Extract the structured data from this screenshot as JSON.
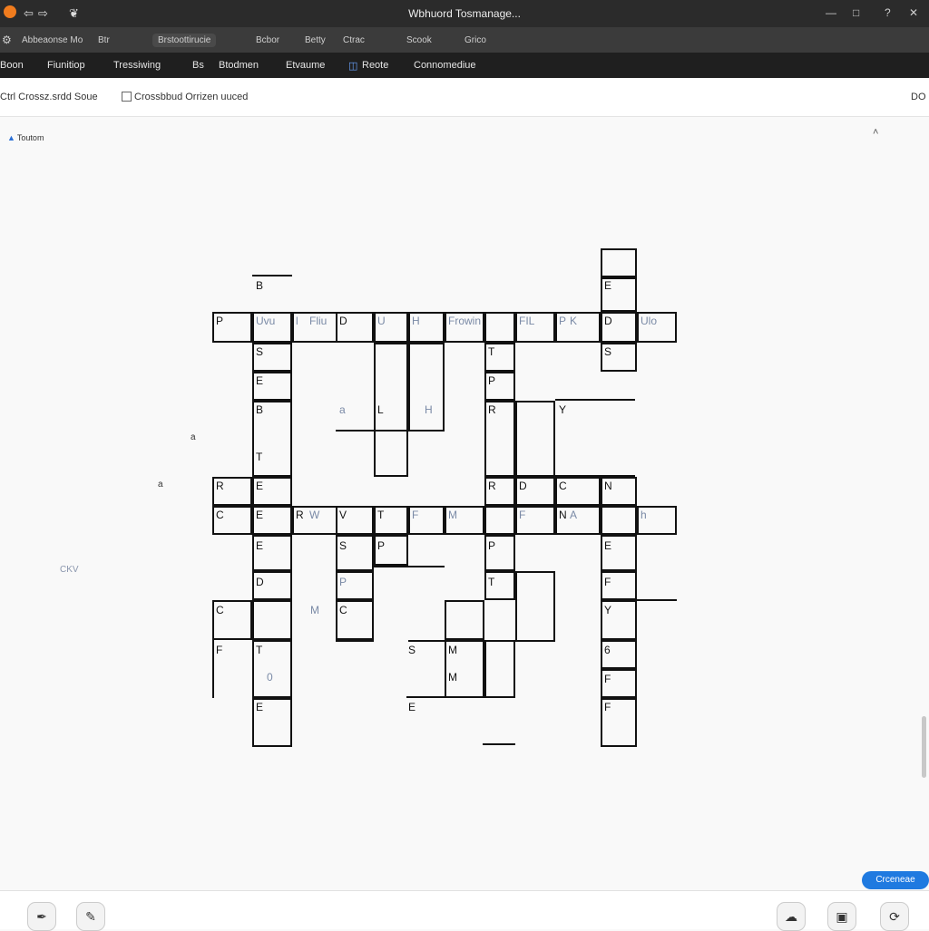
{
  "window": {
    "title": "Wbhuord Tosmanage..."
  },
  "toolbar": {
    "items": [
      "Abbeaonse Mo",
      "Btr",
      "Brstoottirucie",
      "Bcbor",
      "Betty",
      "Ctrac",
      "Scook",
      "Grico"
    ]
  },
  "menubar": {
    "items": [
      "Boon",
      "Fiunitiop",
      "Tressiwing",
      "Bs",
      "Btodmen",
      "Etvaume",
      "Reote",
      "Connomediue"
    ]
  },
  "options": {
    "title": "Ctrl Crossz.srdd Soue",
    "checkbox_label": "Crossbbud Orrizen uuced",
    "right_label": "DO"
  },
  "panel": {
    "title": "Toutom"
  },
  "side_marks": [
    "a",
    "a",
    "CKV"
  ],
  "crossword": {
    "letters": [
      "B",
      "E",
      "P",
      "Uvu",
      "l",
      "Fliu",
      "D",
      "U",
      "H",
      "Frowin",
      "FIL",
      "P",
      "K",
      "D",
      "Ulo",
      "S",
      "T",
      "S",
      "E",
      "P",
      "B",
      "a",
      "L",
      "H",
      "R",
      "Y",
      "T",
      "R",
      "E",
      "R",
      "D",
      "C",
      "N",
      "C",
      "E",
      "R",
      "W",
      "V",
      "T",
      "F",
      "M",
      "F",
      "N",
      "A",
      "h",
      "E",
      "S",
      "P",
      "P",
      "E",
      "D",
      "P",
      "T",
      "F",
      "C",
      "M",
      "C",
      "Y",
      "F",
      "T",
      "S",
      "M",
      "6",
      "0",
      "M",
      "F",
      "E",
      "E",
      "F"
    ]
  },
  "confirm_label": "Crceneae"
}
